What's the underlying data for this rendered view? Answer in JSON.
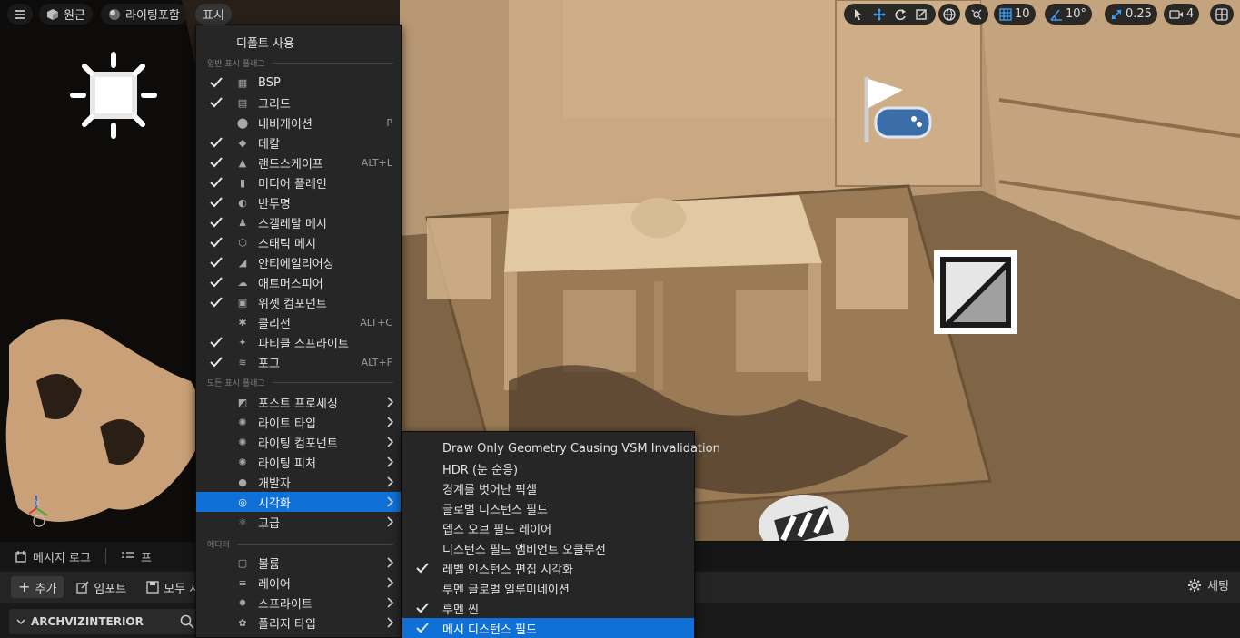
{
  "toolbar": {
    "menu_icon": "hamburger-icon",
    "perspective_label": "원근",
    "lit_label": "라이팅포함",
    "show_label": "표시",
    "grid_snap_value": "10",
    "angle_snap_value": "10°",
    "scale_snap_value": "0.25",
    "camera_speed_value": "4"
  },
  "show_menu": {
    "default_item": "디폴트 사용",
    "section_common": "일반 표시 플래그",
    "section_all": "모든 표시 플래그",
    "section_editor": "에디터",
    "common_flags": [
      {
        "label": "BSP",
        "checked": true,
        "shortcut": "",
        "icon": "bsp-icon"
      },
      {
        "label": "그리드",
        "checked": true,
        "shortcut": "",
        "icon": "grid-icon"
      },
      {
        "label": "내비게이션",
        "checked": false,
        "shortcut": "P",
        "icon": "navigation-pin-icon"
      },
      {
        "label": "데칼",
        "checked": true,
        "shortcut": "",
        "icon": "decal-icon"
      },
      {
        "label": "랜드스케이프",
        "checked": true,
        "shortcut": "ALT+L",
        "icon": "landscape-icon"
      },
      {
        "label": "미디어 플레인",
        "checked": true,
        "shortcut": "",
        "icon": "media-plane-icon"
      },
      {
        "label": "반투명",
        "checked": true,
        "shortcut": "",
        "icon": "translucency-icon"
      },
      {
        "label": "스켈레탈 메시",
        "checked": true,
        "shortcut": "",
        "icon": "skeletal-mesh-icon"
      },
      {
        "label": "스태틱 메시",
        "checked": true,
        "shortcut": "",
        "icon": "static-mesh-icon"
      },
      {
        "label": "안티에일리어싱",
        "checked": true,
        "shortcut": "",
        "icon": "antialiasing-icon"
      },
      {
        "label": "애트머스피어",
        "checked": true,
        "shortcut": "",
        "icon": "atmosphere-icon"
      },
      {
        "label": "위젯 컴포넌트",
        "checked": true,
        "shortcut": "",
        "icon": "widget-component-icon"
      },
      {
        "label": "콜리전",
        "checked": false,
        "shortcut": "ALT+C",
        "icon": "collision-icon"
      },
      {
        "label": "파티클 스프라이트",
        "checked": true,
        "shortcut": "",
        "icon": "particle-sprite-icon"
      },
      {
        "label": "포그",
        "checked": true,
        "shortcut": "ALT+F",
        "icon": "fog-icon"
      }
    ],
    "all_flags": [
      {
        "label": "포스트 프로세싱",
        "icon": "post-process-icon"
      },
      {
        "label": "라이트 타입",
        "icon": "light-type-icon"
      },
      {
        "label": "라이팅 컴포넌트",
        "icon": "lighting-component-icon"
      },
      {
        "label": "라이팅 피처",
        "icon": "lighting-feature-icon"
      },
      {
        "label": "개발자",
        "icon": "developer-icon"
      },
      {
        "label": "시각화",
        "icon": "visualize-icon",
        "highlighted": true
      },
      {
        "label": "고급",
        "icon": "advanced-icon"
      }
    ],
    "editor_flags": [
      {
        "label": "볼륨",
        "icon": "volume-icon"
      },
      {
        "label": "레이어",
        "icon": "layer-icon"
      },
      {
        "label": "스프라이트",
        "icon": "sprite-icon"
      },
      {
        "label": "폴리지 타입",
        "icon": "foliage-icon"
      }
    ]
  },
  "visualize_menu": {
    "items": [
      {
        "label": "Draw Only Geometry Causing VSM Invalidation",
        "checked": false
      },
      {
        "label": "HDR (눈 순응)",
        "checked": false
      },
      {
        "label": "경계를 벗어난 픽셀",
        "checked": false
      },
      {
        "label": "글로벌 디스턴스 필드",
        "checked": false
      },
      {
        "label": "뎁스 오브 필드 레이어",
        "checked": false
      },
      {
        "label": "디스턴스 필드 앰비언트 오클루전",
        "checked": false
      },
      {
        "label": "레벨 인스턴스 편집 시각화",
        "checked": true
      },
      {
        "label": "루멘 글로벌 일루미네이션",
        "checked": false
      },
      {
        "label": "루멘 씬",
        "checked": true
      },
      {
        "label": "메시 디스턴스 필드",
        "checked": true,
        "highlighted": true
      }
    ]
  },
  "bottom_panel": {
    "tab_message_log": "메시지 로그",
    "tab_second": "프",
    "add_label": "추가",
    "import_label": "임포트",
    "save_all_label": "모두 저",
    "settings_label": "세팅",
    "folder_label": "ARCHVIZINTERIOR"
  },
  "colors": {
    "menu_bg": "#262626",
    "highlight": "#0f70d7",
    "accent": "#3aa2ff"
  }
}
